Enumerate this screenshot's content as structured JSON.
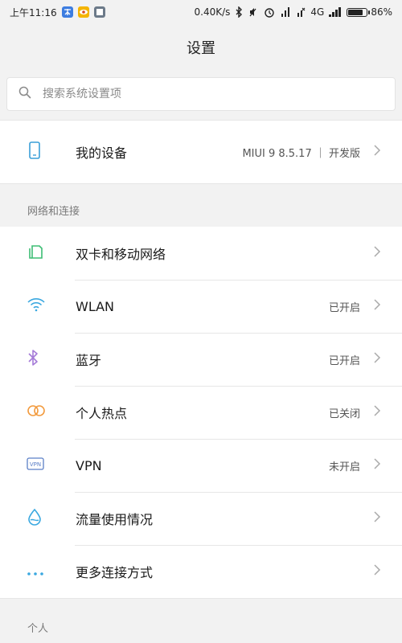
{
  "status_bar": {
    "time": "上午11:16",
    "speed": "0.40K/s",
    "network": "4G",
    "battery_percent": "86%",
    "battery_level": 0.86
  },
  "header": {
    "title": "设置"
  },
  "search": {
    "placeholder": "搜索系统设置项"
  },
  "device": {
    "label": "我的设备",
    "value": "MIUI 9 8.5.17 ｜ 开发版"
  },
  "sections": {
    "network": {
      "title": "网络和连接"
    },
    "personal": {
      "title": "个人"
    }
  },
  "network_items": [
    {
      "label": "双卡和移动网络",
      "value": "",
      "icon": "dual-sim-icon"
    },
    {
      "label": "WLAN",
      "value": "已开启",
      "icon": "wifi-icon"
    },
    {
      "label": "蓝牙",
      "value": "已开启",
      "icon": "bluetooth-icon"
    },
    {
      "label": "个人热点",
      "value": "已关闭",
      "icon": "hotspot-icon"
    },
    {
      "label": "VPN",
      "value": "未开启",
      "icon": "vpn-icon"
    },
    {
      "label": "流量使用情况",
      "value": "",
      "icon": "data-usage-icon"
    },
    {
      "label": "更多连接方式",
      "value": "",
      "icon": "more-icon"
    }
  ]
}
